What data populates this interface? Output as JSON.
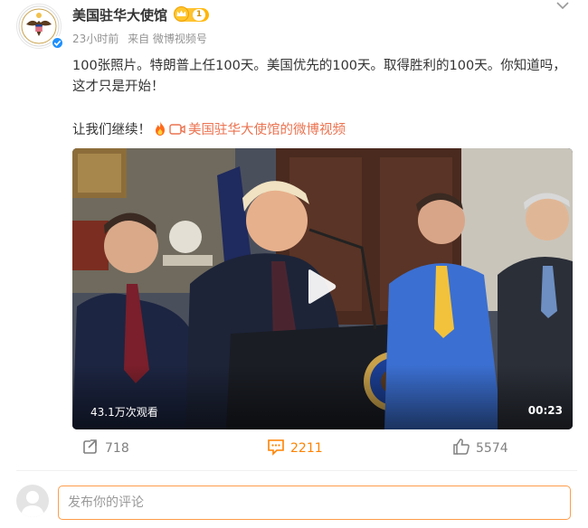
{
  "post": {
    "author_name": "美国驻华大使馆",
    "level_badge": "1",
    "time": "23小时前",
    "source": "来自 微博视频号",
    "text_line1": "100张照片。特朗普上任100天。美国优先的100天。取得胜利的100天。你知道吗，这才只是开始！",
    "text_prefix": "让我们继续！",
    "video_link": "美国驻华大使馆的微博视频"
  },
  "video": {
    "views": "43.1万次观看",
    "duration": "00:23"
  },
  "actions": {
    "repost_count": "718",
    "comment_count": "2211",
    "like_count": "5574"
  },
  "comment": {
    "placeholder": "发布你的评论"
  },
  "colors": {
    "accent": "#ff8200",
    "link": "#eb7350",
    "verified": "#1e90ff"
  },
  "icons": [
    "embassy-seal-avatar",
    "verified-icon",
    "crown-icon",
    "more-icon",
    "fire-icon",
    "video-icon",
    "play-icon",
    "repost-icon",
    "comment-icon",
    "like-icon"
  ]
}
